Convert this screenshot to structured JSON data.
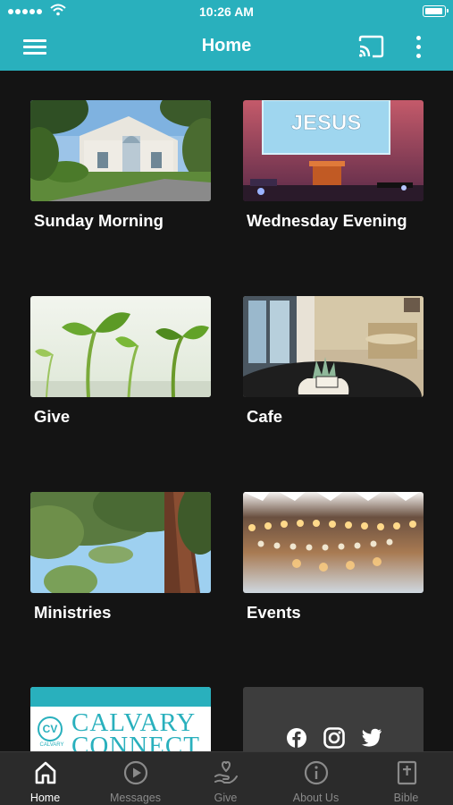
{
  "status_bar": {
    "time": "10:26 AM"
  },
  "app_bar": {
    "title": "Home"
  },
  "tiles": [
    {
      "label": "Sunday Morning"
    },
    {
      "label": "Wednesday Evening"
    },
    {
      "label": "Give"
    },
    {
      "label": "Cafe"
    },
    {
      "label": "Ministries"
    },
    {
      "label": "Events"
    }
  ],
  "connect_card": {
    "badge": "CV",
    "badge_sub": "CALVARY",
    "line1": "CALVARY",
    "line2": "CONNECT"
  },
  "sunday_image": {
    "sign_text": "JESUS"
  },
  "social": {
    "icons": [
      "facebook-icon",
      "instagram-icon",
      "twitter-icon"
    ]
  },
  "tab_bar": {
    "tabs": [
      {
        "label": "Home",
        "icon": "home-icon",
        "active": true
      },
      {
        "label": "Messages",
        "icon": "play-circle-icon",
        "active": false
      },
      {
        "label": "Give",
        "icon": "heart-hand-icon",
        "active": false
      },
      {
        "label": "About Us",
        "icon": "info-icon",
        "active": false
      },
      {
        "label": "Bible",
        "icon": "bible-icon",
        "active": false
      }
    ]
  },
  "colors": {
    "accent": "#29b0bd",
    "background": "#141414",
    "tab_bar": "#2b2b2b"
  }
}
